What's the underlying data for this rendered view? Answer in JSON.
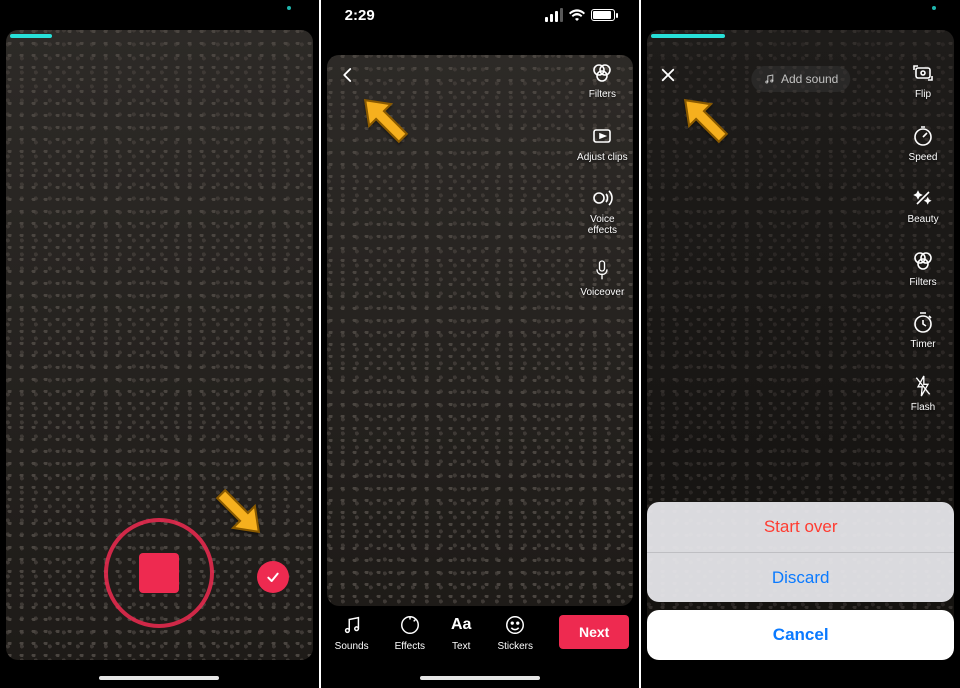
{
  "panel2": {
    "status_time": "2:29",
    "tools": [
      {
        "name": "filters",
        "label": "Filters"
      },
      {
        "name": "adjust-clips",
        "label": "Adjust clips"
      },
      {
        "name": "voice-effects",
        "label": "Voice\neffects"
      },
      {
        "name": "voiceover",
        "label": "Voiceover"
      }
    ],
    "bottom": [
      {
        "name": "sounds",
        "label": "Sounds"
      },
      {
        "name": "effects",
        "label": "Effects"
      },
      {
        "name": "text",
        "label": "Text"
      },
      {
        "name": "stickers",
        "label": "Stickers"
      }
    ],
    "next_label": "Next"
  },
  "panel3": {
    "add_sound_label": "Add sound",
    "tools": [
      {
        "name": "flip",
        "label": "Flip"
      },
      {
        "name": "speed",
        "label": "Speed"
      },
      {
        "name": "beauty",
        "label": "Beauty"
      },
      {
        "name": "filters",
        "label": "Filters"
      },
      {
        "name": "timer",
        "label": "Timer"
      },
      {
        "name": "flash",
        "label": "Flash"
      }
    ],
    "sheet": {
      "start_over": "Start over",
      "discard": "Discard",
      "cancel": "Cancel"
    }
  }
}
